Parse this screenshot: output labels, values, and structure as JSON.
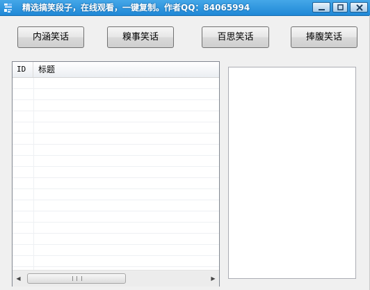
{
  "window": {
    "title": "精选搞笑段子，在线观看，一键复制。作者QQ：84065994",
    "icon": "app-icon"
  },
  "buttons": [
    {
      "label": "内涵笑话"
    },
    {
      "label": "糗事笑话"
    },
    {
      "label": "百思笑话"
    },
    {
      "label": "捧腹笑话"
    }
  ],
  "list": {
    "columns": [
      "ID",
      "标题"
    ],
    "rows": []
  },
  "content_panel": {
    "text": ""
  },
  "colors": {
    "titlebar": "#2b91dd",
    "window_bg": "#f0f0f0"
  }
}
